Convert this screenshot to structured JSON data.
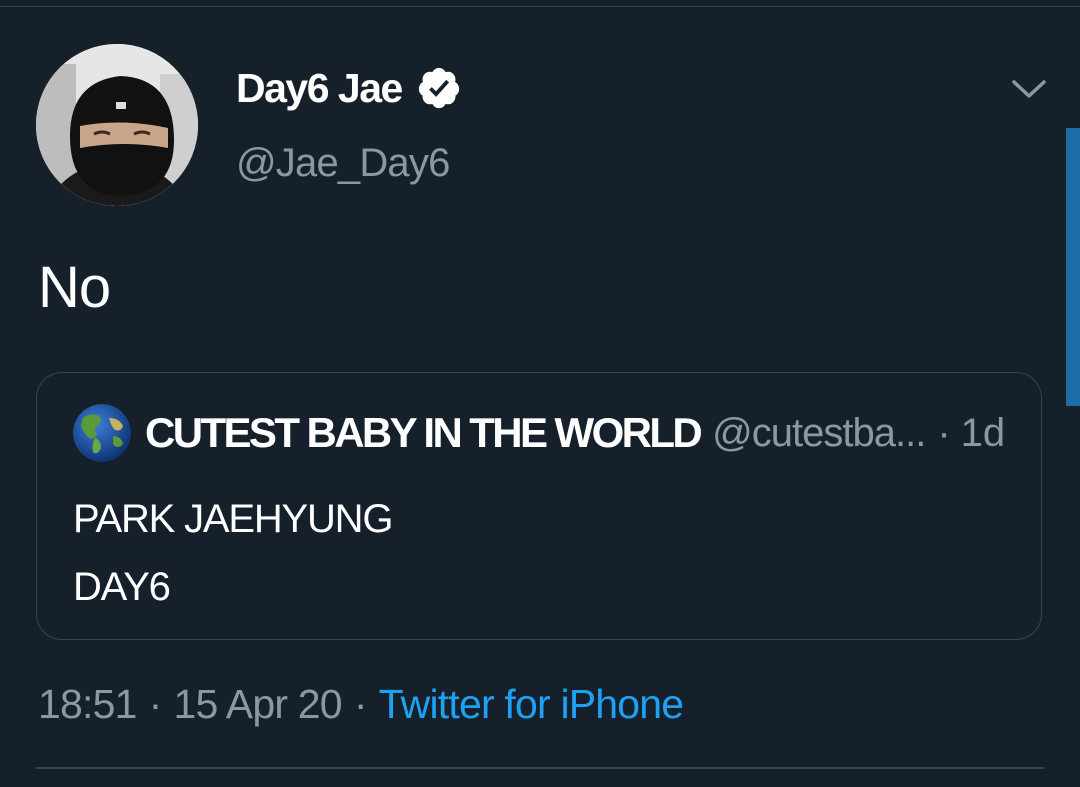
{
  "tweet": {
    "author": {
      "name": "Day6 Jae",
      "handle": "@Jae_Day6",
      "verified": true
    },
    "text": "No",
    "quoted": {
      "author_name": "CUTEST BABY IN THE WORLD",
      "handle": "@cutestba...",
      "separator": "·",
      "age": "1d",
      "lines": [
        "PARK JAEHYUNG",
        "DAY6"
      ]
    },
    "meta": {
      "time": "18:51",
      "separator": "·",
      "date": "15 Apr 20",
      "source": "Twitter for iPhone"
    }
  },
  "icons": {
    "verified": "verified-badge-icon",
    "more": "chevron-down-icon",
    "quote_avatar": "globe-icon"
  },
  "colors": {
    "background": "#15202b",
    "border": "#38444d",
    "secondary_text": "#8899a6",
    "link": "#1da1f2",
    "primary_text": "#ffffff"
  }
}
